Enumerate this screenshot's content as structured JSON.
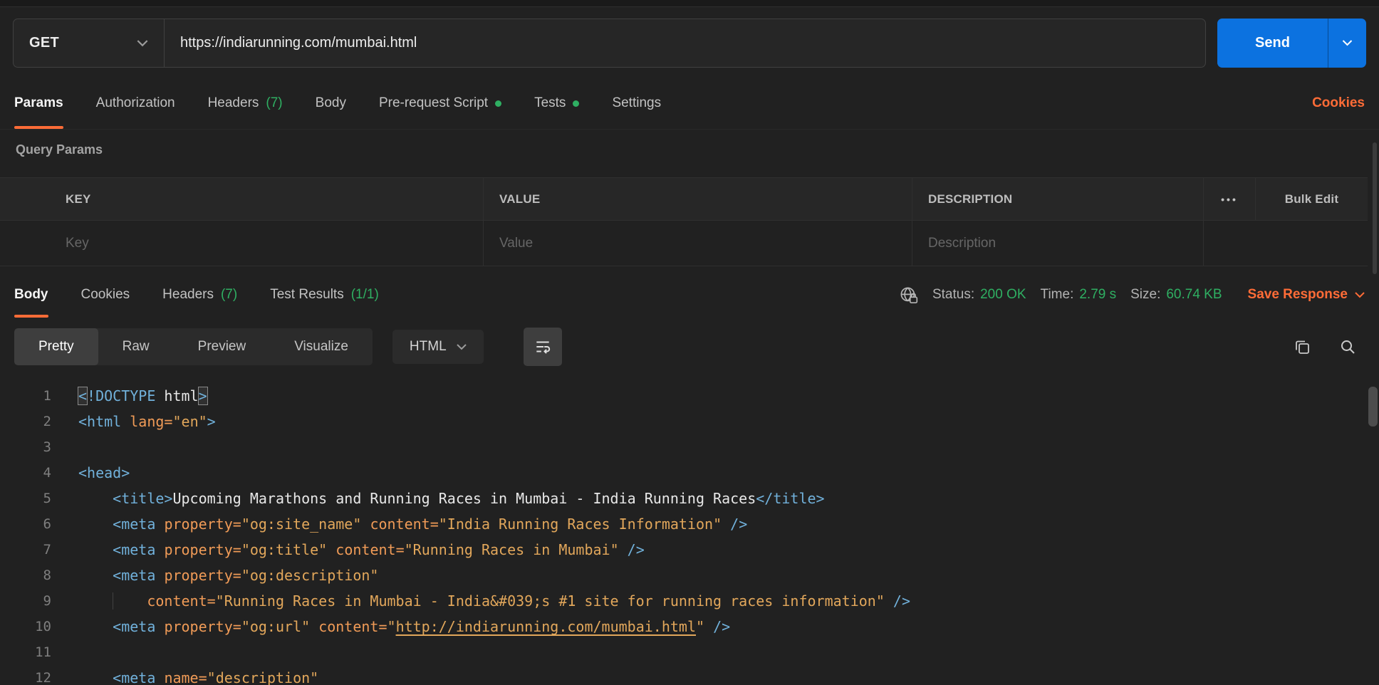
{
  "theme": {
    "accent-orange": "#FF6C37",
    "success-green": "#2FAF62",
    "send-blue": "#0C72E0",
    "bg": "#212121",
    "panel": "#262626",
    "code-tag": "#71B1DB",
    "code-attr": "#F09B57",
    "code-str": "#E2A75B",
    "code-text": "#E8E8E8"
  },
  "request": {
    "method": "GET",
    "url": "https://indiarunning.com/mumbai.html",
    "send_label": "Send",
    "tabs": [
      {
        "label": "Params",
        "active": true
      },
      {
        "label": "Authorization"
      },
      {
        "label": "Headers",
        "count": "(7)"
      },
      {
        "label": "Body"
      },
      {
        "label": "Pre-request Script",
        "dot": true
      },
      {
        "label": "Tests",
        "dot": true
      },
      {
        "label": "Settings"
      }
    ],
    "cookies_link": "Cookies",
    "query_params": {
      "title": "Query Params",
      "columns": [
        "KEY",
        "VALUE",
        "DESCRIPTION"
      ],
      "more_icon": "•••",
      "bulk_edit_label": "Bulk Edit",
      "placeholders": [
        "Key",
        "Value",
        "Description"
      ]
    }
  },
  "response": {
    "tabs": [
      {
        "label": "Body",
        "active": true
      },
      {
        "label": "Cookies"
      },
      {
        "label": "Headers",
        "count": "(7)"
      },
      {
        "label": "Test Results",
        "count": "(1/1)"
      }
    ],
    "meta": {
      "status_label": "Status:",
      "status_value": "200 OK",
      "time_label": "Time:",
      "time_value": "2.79 s",
      "size_label": "Size:",
      "size_value": "60.74 KB",
      "save_label": "Save Response"
    },
    "view_tabs": [
      {
        "label": "Pretty",
        "active": true
      },
      {
        "label": "Raw"
      },
      {
        "label": "Preview"
      },
      {
        "label": "Visualize"
      }
    ],
    "language": "HTML"
  },
  "code": {
    "lines": [
      {
        "n": "1",
        "tokens": [
          {
            "c": "tag bh",
            "v": "<"
          },
          {
            "c": "tag",
            "v": "!DOCTYPE"
          },
          {
            "c": "txt",
            "v": " html"
          },
          {
            "c": "tag bh",
            "v": ">"
          }
        ]
      },
      {
        "n": "2",
        "tokens": [
          {
            "c": "tag",
            "v": "<html"
          },
          {
            "c": "txt",
            "v": " "
          },
          {
            "c": "attr",
            "v": "lang="
          },
          {
            "c": "str",
            "v": "\"en\""
          },
          {
            "c": "tag",
            "v": ">"
          }
        ]
      },
      {
        "n": "3",
        "tokens": []
      },
      {
        "n": "4",
        "tokens": [
          {
            "c": "tag",
            "v": "<head>"
          }
        ]
      },
      {
        "n": "5",
        "tokens": [
          {
            "c": "txt",
            "v": "    "
          },
          {
            "c": "tag",
            "v": "<title>"
          },
          {
            "c": "txt",
            "v": "Upcoming Marathons and Running Races in Mumbai - India Running Races"
          },
          {
            "c": "tag",
            "v": "</title>"
          }
        ]
      },
      {
        "n": "6",
        "tokens": [
          {
            "c": "txt",
            "v": "    "
          },
          {
            "c": "tag",
            "v": "<meta"
          },
          {
            "c": "txt",
            "v": " "
          },
          {
            "c": "attr",
            "v": "property="
          },
          {
            "c": "str",
            "v": "\"og:site_name\""
          },
          {
            "c": "txt",
            "v": " "
          },
          {
            "c": "attr",
            "v": "content="
          },
          {
            "c": "str",
            "v": "\"India Running Races Information\""
          },
          {
            "c": "tag",
            "v": " />"
          }
        ]
      },
      {
        "n": "7",
        "tokens": [
          {
            "c": "txt",
            "v": "    "
          },
          {
            "c": "tag",
            "v": "<meta"
          },
          {
            "c": "txt",
            "v": " "
          },
          {
            "c": "attr",
            "v": "property="
          },
          {
            "c": "str",
            "v": "\"og:title\""
          },
          {
            "c": "txt",
            "v": " "
          },
          {
            "c": "attr",
            "v": "content="
          },
          {
            "c": "str",
            "v": "\"Running Races in Mumbai\""
          },
          {
            "c": "tag",
            "v": " />"
          }
        ]
      },
      {
        "n": "8",
        "tokens": [
          {
            "c": "txt",
            "v": "    "
          },
          {
            "c": "tag",
            "v": "<meta"
          },
          {
            "c": "txt",
            "v": " "
          },
          {
            "c": "attr",
            "v": "property="
          },
          {
            "c": "str",
            "v": "\"og:description\""
          }
        ]
      },
      {
        "n": "9",
        "tokens": [
          {
            "c": "txt",
            "v": "    "
          },
          {
            "c": "guide",
            "v": "    "
          },
          {
            "c": "attr",
            "v": "content="
          },
          {
            "c": "str",
            "v": "\"Running Races in Mumbai - India&#039;s #1 site for running races information\""
          },
          {
            "c": "tag",
            "v": " />"
          }
        ]
      },
      {
        "n": "10",
        "tokens": [
          {
            "c": "txt",
            "v": "    "
          },
          {
            "c": "tag",
            "v": "<meta"
          },
          {
            "c": "txt",
            "v": " "
          },
          {
            "c": "attr",
            "v": "property="
          },
          {
            "c": "str",
            "v": "\"og:url\""
          },
          {
            "c": "txt",
            "v": " "
          },
          {
            "c": "attr",
            "v": "content="
          },
          {
            "c": "str",
            "v": "\""
          },
          {
            "c": "str link",
            "v": "http://indiarunning.com/mumbai.html"
          },
          {
            "c": "str",
            "v": "\""
          },
          {
            "c": "tag",
            "v": " />"
          }
        ]
      },
      {
        "n": "11",
        "tokens": []
      },
      {
        "n": "12",
        "tokens": [
          {
            "c": "txt",
            "v": "    "
          },
          {
            "c": "tag",
            "v": "<meta"
          },
          {
            "c": "txt",
            "v": " "
          },
          {
            "c": "attr",
            "v": "name="
          },
          {
            "c": "str",
            "v": "\"description\""
          }
        ]
      }
    ]
  }
}
